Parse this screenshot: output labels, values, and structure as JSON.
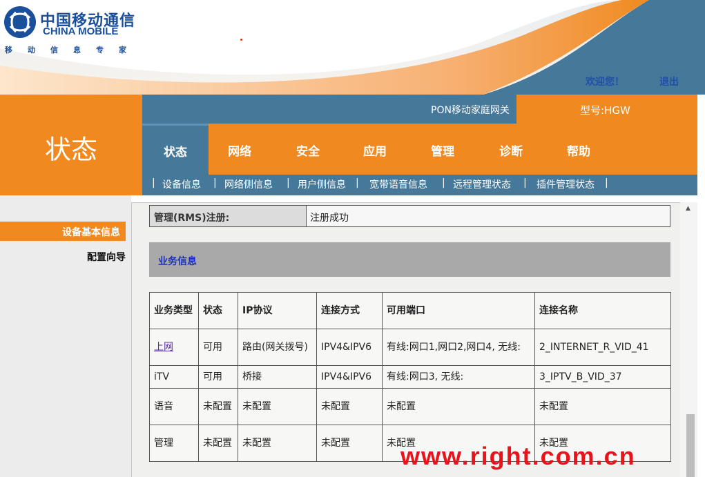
{
  "brand": {
    "name_cn": "中国移动通信",
    "name_en": "CHINA MOBILE",
    "slogan": "移动信息专家"
  },
  "header": {
    "welcome": "欢迎您！",
    "logout": "退出"
  },
  "nav": {
    "section_title": "状态",
    "gateway_name": "PON移动家庭网关",
    "model": "型号:HGW",
    "tabs": [
      "状态",
      "网络",
      "安全",
      "应用",
      "管理",
      "诊断",
      "帮助"
    ],
    "active_tab": "状态",
    "subtabs": [
      "设备信息",
      "网络侧信息",
      "用户侧信息",
      "宽带语音信息",
      "远程管理状态",
      "插件管理状态"
    ]
  },
  "sidebar": {
    "items": [
      "设备基本信息",
      "配置向导"
    ],
    "active": "设备基本信息"
  },
  "main": {
    "rms": {
      "label": "管理(RMS)注册:",
      "value": "注册成功"
    },
    "service_section_title": "业务信息",
    "table": {
      "headers": [
        "业务类型",
        "状态",
        "IP协议",
        "连接方式",
        "可用端口",
        "连接名称"
      ],
      "rows": [
        [
          "上网",
          "可用",
          "路由(网关拨号)",
          "IPV4&IPV6",
          "有线:网口1,网口2,网口4, 无线:",
          "2_INTERNET_R_VID_41"
        ],
        [
          "iTV",
          "可用",
          "桥接",
          "IPV4&IPV6",
          "有线:网口3, 无线:",
          "3_IPTV_B_VID_37"
        ],
        [
          "语音",
          "未配置",
          "未配置",
          "未配置",
          "未配置",
          "未配置"
        ],
        [
          "管理",
          "未配置",
          "未配置",
          "未配置",
          "未配置",
          "未配置"
        ]
      ]
    }
  },
  "watermark": "www.right.com.cn",
  "colors": {
    "orange": "#f08a20",
    "steel_blue": "#46789a",
    "brand_blue": "#1a4f9c",
    "watermark_red": "#e8141a"
  }
}
